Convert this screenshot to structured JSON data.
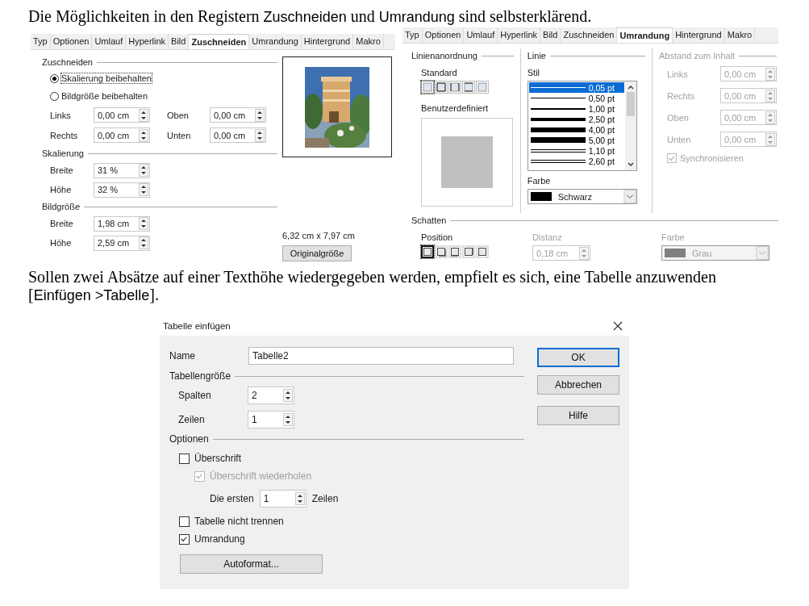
{
  "intro": [
    {
      "text": "Die Möglichkeiten in den Registern ",
      "kind": "plain"
    },
    {
      "text": "Zuschneiden",
      "kind": "ui"
    },
    {
      "text": " und ",
      "kind": "plain"
    },
    {
      "text": "Umrandung",
      "kind": "ui"
    },
    {
      "text": " sind selbsterklärend.",
      "kind": "plain"
    }
  ],
  "crop_tab": {
    "tabs": [
      {
        "label": "Typ",
        "selected": false
      },
      {
        "label": "Optionen",
        "selected": false
      },
      {
        "label": "Umlauf",
        "selected": false
      },
      {
        "label": "Hyperlink",
        "selected": false
      },
      {
        "label": "Bild",
        "selected": false
      },
      {
        "label": "Zuschneiden",
        "selected": true
      },
      {
        "label": "Umrandung",
        "selected": false
      },
      {
        "label": "Hintergrund",
        "selected": false
      },
      {
        "label": "Makro",
        "selected": false
      }
    ],
    "crop": {
      "title": "Zuschneiden",
      "options": [
        {
          "label": "Skalierung beibehalten",
          "selected": true
        },
        {
          "label": "Bildgröße beibehalten",
          "selected": false
        }
      ],
      "fields": [
        {
          "label": "Links",
          "value": "0,00 cm"
        },
        {
          "label": "Oben",
          "value": "0,00 cm"
        },
        {
          "label": "Rechts",
          "value": "0,00 cm"
        },
        {
          "label": "Unten",
          "value": "0,00 cm"
        }
      ]
    },
    "scale": {
      "title": "Skalierung",
      "fields": [
        {
          "label": "Breite",
          "value": "31 %"
        },
        {
          "label": "Höhe",
          "value": "32 %"
        }
      ]
    },
    "size": {
      "title": "Bildgröße",
      "fields": [
        {
          "label": "Breite",
          "value": "1,98 cm"
        },
        {
          "label": "Höhe",
          "value": "2,59 cm"
        }
      ]
    },
    "original_size": "6,32 cm x 7,97 cm",
    "button": "Originalgröße"
  },
  "border_tab": {
    "tabs": [
      {
        "label": "Typ",
        "selected": false
      },
      {
        "label": "Optionen",
        "selected": false
      },
      {
        "label": "Umlauf",
        "selected": false
      },
      {
        "label": "Hyperlink",
        "selected": false
      },
      {
        "label": "Bild",
        "selected": false
      },
      {
        "label": "Zuschneiden",
        "selected": false
      },
      {
        "label": "Umrandung",
        "selected": true
      },
      {
        "label": "Hintergrund",
        "selected": false
      },
      {
        "label": "Makro",
        "selected": false
      }
    ],
    "arrangement": {
      "title": "Linienanordnung",
      "standard_label": "Standard",
      "presets": [
        {
          "selected": true
        },
        {
          "selected": false
        },
        {
          "selected": false
        },
        {
          "selected": false
        },
        {
          "selected": false
        }
      ],
      "custom_label": "Benutzerdefiniert"
    },
    "line": {
      "title": "Linie",
      "style_label": "Stil",
      "styles": [
        {
          "label": "0,05 pt",
          "kind": "single",
          "selected": true
        },
        {
          "label": "0,50 pt",
          "kind": "single",
          "selected": false
        },
        {
          "label": "1,00 pt",
          "kind": "single",
          "selected": false
        },
        {
          "label": "2,50 pt",
          "kind": "single",
          "selected": false
        },
        {
          "label": "4,00 pt",
          "kind": "single",
          "selected": false
        },
        {
          "label": "5,00 pt",
          "kind": "single",
          "selected": false
        },
        {
          "label": "1,10 pt",
          "kind": "double",
          "selected": false
        },
        {
          "label": "2,60 pt",
          "kind": "double",
          "selected": false
        }
      ],
      "color_label": "Farbe",
      "color_value": "Schwarz"
    },
    "spacing": {
      "title": "Abstand zum Inhalt",
      "disabled": true,
      "fields": [
        {
          "label": "Links",
          "value": "0,00 cm"
        },
        {
          "label": "Rechts",
          "value": "0,00 cm"
        },
        {
          "label": "Oben",
          "value": "0,00 cm"
        },
        {
          "label": "Unten",
          "value": "0,00 cm"
        }
      ],
      "sync": {
        "label": "Synchronisieren",
        "checked": true,
        "disabled": true
      }
    },
    "shadow": {
      "title": "Schatten",
      "position_label": "Position",
      "positions": [
        {
          "selected": true
        },
        {
          "selected": false
        },
        {
          "selected": false
        },
        {
          "selected": false
        },
        {
          "selected": false
        }
      ],
      "distance_label": "Distanz",
      "distance": "0,18 cm",
      "distance_disabled": true,
      "color_label": "Farbe",
      "color_value": "Grau",
      "color_disabled": true
    }
  },
  "outro": [
    {
      "text": "Sollen zwei Absätze auf einer Texthöhe wiedergegeben werden, empfielt es sich, eine Tabelle anzuwenden [",
      "kind": "plain"
    },
    {
      "text": "Einfügen >Tabelle",
      "kind": "ui"
    },
    {
      "text": "].",
      "kind": "plain"
    }
  ],
  "dialog": {
    "title": "Tabelle einfügen",
    "name_label": "Name",
    "name_value": "Tabelle2",
    "size_title": "Tabellengröße",
    "fields": [
      {
        "label": "Spalten",
        "value": "2"
      },
      {
        "label": "Zeilen",
        "value": "1"
      }
    ],
    "options_title": "Optionen",
    "heading": {
      "label": "Überschrift",
      "checked": false,
      "disabled": false
    },
    "repeat": {
      "label": "Überschrift wiederholen",
      "checked": true,
      "disabled": true
    },
    "first_rows": {
      "label": "Die ersten",
      "value": "1",
      "unit": "Zeilen"
    },
    "checks": [
      {
        "label": "Tabelle nicht trennen",
        "checked": false,
        "disabled": false
      },
      {
        "label": "Umrandung",
        "checked": true,
        "disabled": false
      }
    ],
    "autoformat": "Autoformat...",
    "buttons": [
      {
        "label": "OK",
        "default": true
      },
      {
        "label": "Abbrechen",
        "default": false
      },
      {
        "label": "Hilfe",
        "default": false
      }
    ]
  }
}
